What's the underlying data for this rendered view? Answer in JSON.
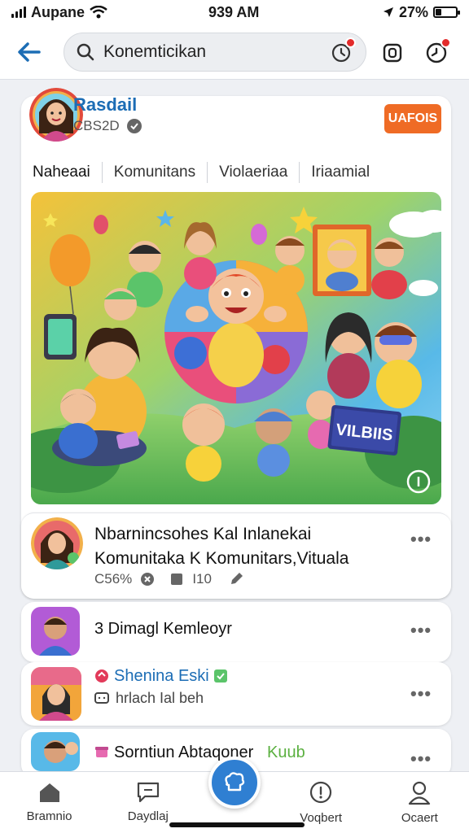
{
  "status_bar": {
    "carrier": "Aupane",
    "time": "939 AM",
    "battery_pct": "27%",
    "battery_level": 0.27
  },
  "search": {
    "value": "Konemticikan"
  },
  "profile": {
    "name": "Rasdail",
    "meta": "CBS2D",
    "follow_label": "UAFOIS"
  },
  "tabs": [
    "Naheaai",
    "Komunitans",
    "Violaeriaa",
    "Iriaamial"
  ],
  "hero": {
    "sign_text": "VILBIIS"
  },
  "post": {
    "title_line1": "Nbarnincsohes Kal Inlanekai",
    "title_line2": "Komunitaka K Komunitars,Vituala",
    "stat_percent": "C56%",
    "stat_count": "I10"
  },
  "list": [
    {
      "title": "3  Dimagl Kemleoyr"
    },
    {
      "title": "Shenina Eski",
      "subtitle": "hrlach Ial beh"
    },
    {
      "title": "Sorntiun Abtaqoner",
      "tag": "Kuub"
    }
  ],
  "bottom_nav": [
    "Bramnio",
    "Daydlaj",
    "Voqbert",
    "Ocaert"
  ],
  "colors": {
    "accent_blue": "#1c6db5",
    "fab_blue": "#2f7fd2",
    "follow_orange": "#ef6b25",
    "badge_red": "#e32b2b"
  }
}
